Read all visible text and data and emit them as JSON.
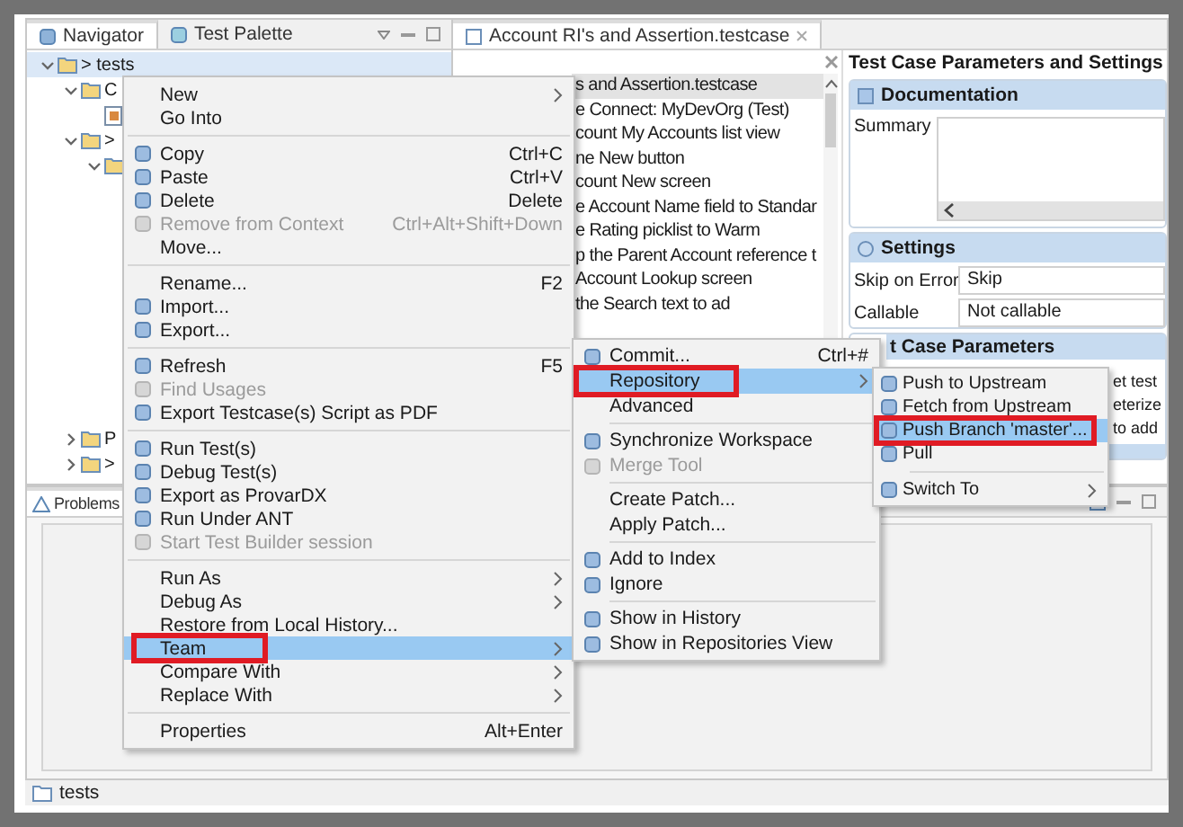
{
  "navigator": {
    "tabs": [
      {
        "label": "Navigator",
        "selected": true
      },
      {
        "label": "Test Palette",
        "selected": false
      }
    ],
    "tree": [
      {
        "label": "> tests",
        "selected": true,
        "expanded": true,
        "children": [
          {
            "label": "C",
            "selected": false,
            "expanded": true,
            "children": [
              {
                "kind": "file",
                "selected": false
              }
            ]
          },
          {
            "label": ">",
            "selected": false,
            "expanded": true,
            "children": [
              {
                "kind": "folder",
                "selected": false,
                "expanded": true
              }
            ]
          }
        ]
      }
    ],
    "more_items": [
      {
        "label": "P",
        "selected": false,
        "expanded": false
      },
      {
        "label": ">",
        "selected": false,
        "expanded": false
      }
    ]
  },
  "editor": {
    "tab": {
      "label": "Account RI's and Assertion.testcase"
    },
    "steps": [
      {
        "text": "s and Assertion.testcase",
        "selected": true
      },
      {
        "text": "e Connect: MyDevOrg (Test)",
        "selected": false
      },
      {
        "text": "count My Accounts list view",
        "selected": false
      },
      {
        "text": "ne New button",
        "selected": false
      },
      {
        "text": "count New screen",
        "selected": false
      },
      {
        "text": "e Account Name field to Standar",
        "selected": false
      },
      {
        "text": "e Rating picklist to Warm",
        "selected": false
      },
      {
        "text": "p the Parent Account reference t",
        "selected": false
      },
      {
        "text": "Account Lookup screen",
        "selected": false
      },
      {
        "text": "the Search text to ad",
        "selected": false
      }
    ]
  },
  "params": {
    "title": "Test Case Parameters and Settings",
    "documentation": {
      "heading": "Documentation",
      "summary_label": "Summary"
    },
    "settings": {
      "heading": "Settings",
      "fields": [
        {
          "label": "Skip on Error",
          "value": "Skip"
        },
        {
          "label": "Callable",
          "value": "Not callable"
        }
      ]
    },
    "parameters": {
      "heading": "t Case Parameters",
      "lines": [
        "et test",
        "eterize",
        "to add"
      ]
    }
  },
  "problems": {
    "tab": "Problems"
  },
  "status_bar": {
    "text": "tests"
  },
  "menus": [
    {
      "kind": "context",
      "items": [
        {
          "kind": "item",
          "label": "New",
          "icon": false,
          "disabled": false,
          "selected": false,
          "submenu": true,
          "annotated": false
        },
        {
          "kind": "item",
          "label": "Go Into",
          "icon": false,
          "disabled": false,
          "selected": false,
          "submenu": false,
          "annotated": false
        },
        {
          "kind": "separator"
        },
        {
          "kind": "item",
          "label": "Copy",
          "shortcut": "Ctrl+C",
          "icon": true,
          "disabled": false,
          "selected": false,
          "submenu": false,
          "annotated": false
        },
        {
          "kind": "item",
          "label": "Paste",
          "shortcut": "Ctrl+V",
          "icon": true,
          "disabled": false,
          "selected": false,
          "submenu": false,
          "annotated": false
        },
        {
          "kind": "item",
          "label": "Delete",
          "shortcut": "Delete",
          "icon": true,
          "disabled": false,
          "selected": false,
          "submenu": false,
          "annotated": false
        },
        {
          "kind": "item",
          "label": "Remove from Context",
          "shortcut": "Ctrl+Alt+Shift+Down",
          "icon": true,
          "disabled": true,
          "selected": false,
          "submenu": false,
          "annotated": false
        },
        {
          "kind": "item",
          "label": "Move...",
          "icon": false,
          "disabled": false,
          "selected": false,
          "submenu": false,
          "annotated": false
        },
        {
          "kind": "separator"
        },
        {
          "kind": "item",
          "label": "Rename...",
          "shortcut": "F2",
          "icon": false,
          "disabled": false,
          "selected": false,
          "submenu": false,
          "annotated": false
        },
        {
          "kind": "item",
          "label": "Import...",
          "icon": true,
          "disabled": false,
          "selected": false,
          "submenu": false,
          "annotated": false
        },
        {
          "kind": "item",
          "label": "Export...",
          "icon": true,
          "disabled": false,
          "selected": false,
          "submenu": false,
          "annotated": false
        },
        {
          "kind": "separator"
        },
        {
          "kind": "item",
          "label": "Refresh",
          "shortcut": "F5",
          "icon": true,
          "disabled": false,
          "selected": false,
          "submenu": false,
          "annotated": false
        },
        {
          "kind": "item",
          "label": "Find Usages",
          "icon": true,
          "disabled": true,
          "selected": false,
          "submenu": false,
          "annotated": false
        },
        {
          "kind": "item",
          "label": "Export Testcase(s) Script as PDF",
          "icon": true,
          "disabled": false,
          "selected": false,
          "submenu": false,
          "annotated": false
        },
        {
          "kind": "separator"
        },
        {
          "kind": "item",
          "label": "Run Test(s)",
          "icon": true,
          "disabled": false,
          "selected": false,
          "submenu": false,
          "annotated": false
        },
        {
          "kind": "item",
          "label": "Debug Test(s)",
          "icon": true,
          "disabled": false,
          "selected": false,
          "submenu": false,
          "annotated": false
        },
        {
          "kind": "item",
          "label": "Export as ProvarDX",
          "icon": true,
          "disabled": false,
          "selected": false,
          "submenu": false,
          "annotated": false
        },
        {
          "kind": "item",
          "label": "Run Under ANT",
          "icon": true,
          "disabled": false,
          "selected": false,
          "submenu": false,
          "annotated": false
        },
        {
          "kind": "item",
          "label": "Start Test Builder session",
          "icon": true,
          "disabled": true,
          "selected": false,
          "submenu": false,
          "annotated": false
        },
        {
          "kind": "separator"
        },
        {
          "kind": "item",
          "label": "Run As",
          "icon": false,
          "disabled": false,
          "selected": false,
          "submenu": true,
          "annotated": false
        },
        {
          "kind": "item",
          "label": "Debug As",
          "icon": false,
          "disabled": false,
          "selected": false,
          "submenu": true,
          "annotated": false
        },
        {
          "kind": "item",
          "label": "Restore from Local History...",
          "icon": false,
          "disabled": false,
          "selected": false,
          "submenu": false,
          "annotated": false
        },
        {
          "kind": "item",
          "label": "Team",
          "icon": false,
          "disabled": false,
          "selected": true,
          "submenu": true,
          "annotated": true
        },
        {
          "kind": "item",
          "label": "Compare With",
          "icon": false,
          "disabled": false,
          "selected": false,
          "submenu": true,
          "annotated": false
        },
        {
          "kind": "item",
          "label": "Replace With",
          "icon": false,
          "disabled": false,
          "selected": false,
          "submenu": true,
          "annotated": false
        },
        {
          "kind": "separator"
        },
        {
          "kind": "item",
          "label": "Properties",
          "shortcut": "Alt+Enter",
          "icon": false,
          "disabled": false,
          "selected": false,
          "submenu": false,
          "annotated": false
        }
      ]
    },
    {
      "kind": "team",
      "items": [
        {
          "kind": "item",
          "label": "Commit...",
          "shortcut": "Ctrl+#",
          "icon": true,
          "disabled": false,
          "selected": false,
          "submenu": false,
          "annotated": false
        },
        {
          "kind": "item",
          "label": "Repository",
          "icon": false,
          "disabled": false,
          "selected": true,
          "submenu": true,
          "annotated": true
        },
        {
          "kind": "item",
          "label": "Advanced",
          "icon": false,
          "disabled": false,
          "selected": false,
          "submenu": false,
          "annotated": false
        },
        {
          "kind": "separator"
        },
        {
          "kind": "item",
          "label": "Synchronize Workspace",
          "icon": true,
          "disabled": false,
          "selected": false,
          "submenu": false,
          "annotated": false
        },
        {
          "kind": "item",
          "label": "Merge Tool",
          "icon": true,
          "disabled": true,
          "selected": false,
          "submenu": false,
          "annotated": false
        },
        {
          "kind": "separator"
        },
        {
          "kind": "item",
          "label": "Create Patch...",
          "icon": false,
          "disabled": false,
          "selected": false,
          "submenu": false,
          "annotated": false
        },
        {
          "kind": "item",
          "label": "Apply Patch...",
          "icon": false,
          "disabled": false,
          "selected": false,
          "submenu": false,
          "annotated": false
        },
        {
          "kind": "separator"
        },
        {
          "kind": "item",
          "label": "Add to Index",
          "icon": true,
          "disabled": false,
          "selected": false,
          "submenu": false,
          "annotated": false
        },
        {
          "kind": "item",
          "label": "Ignore",
          "icon": true,
          "disabled": false,
          "selected": false,
          "submenu": false,
          "annotated": false
        },
        {
          "kind": "separator"
        },
        {
          "kind": "item",
          "label": "Show in History",
          "icon": true,
          "disabled": false,
          "selected": false,
          "submenu": false,
          "annotated": false
        },
        {
          "kind": "item",
          "label": "Show in Repositories View",
          "icon": true,
          "disabled": false,
          "selected": false,
          "submenu": false,
          "annotated": false
        }
      ]
    },
    {
      "kind": "repository",
      "items": [
        {
          "kind": "item",
          "label": "Push to Upstream",
          "icon": true,
          "disabled": false,
          "selected": false,
          "submenu": false,
          "annotated": false
        },
        {
          "kind": "item",
          "label": "Fetch from Upstream",
          "icon": true,
          "disabled": false,
          "selected": false,
          "submenu": false,
          "annotated": false
        },
        {
          "kind": "item",
          "label": "Push Branch 'master'...",
          "icon": true,
          "disabled": false,
          "selected": true,
          "submenu": false,
          "annotated": true
        },
        {
          "kind": "item",
          "label": "Pull",
          "icon": true,
          "disabled": false,
          "selected": false,
          "submenu": false,
          "annotated": false
        },
        {
          "kind": "separator"
        },
        {
          "kind": "item",
          "label": "Switch To",
          "icon": true,
          "disabled": false,
          "selected": false,
          "submenu": true,
          "annotated": false
        }
      ]
    }
  ]
}
